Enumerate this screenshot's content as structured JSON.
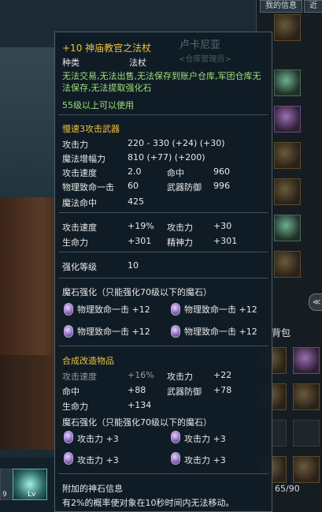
{
  "tooltip": {
    "enhance_level": "+10",
    "item_name": "神庙教官之法杖",
    "type_label": "种类",
    "type_value": "法杖",
    "restrictions": "无法交易,无法出售,无法保存到账户仓库,军团仓库无法保存,无法提取强化石",
    "level_req": "55级以上可以使用",
    "weapon_class": "慢速3攻击武器",
    "stats": [
      {
        "label": "攻击力",
        "value": "220 - 330 (+24) (+30)"
      },
      {
        "label": "魔法增幅力",
        "value": "810 (+77) (+200)"
      }
    ],
    "stats_pairs": [
      {
        "l1": "攻击速度",
        "v1": "2.0",
        "l2": "命中",
        "v2": "960"
      },
      {
        "l1": "物理致命一击",
        "v1": "60",
        "l2": "武器防御",
        "v2": "996"
      }
    ],
    "magic_hit": {
      "label": "魔法命中",
      "value": "425"
    },
    "bonus": [
      {
        "l1": "攻击速度",
        "v1": "+19%",
        "l2": "攻击力",
        "v2": "+30"
      },
      {
        "l1": "生命力",
        "v1": "+301",
        "l2": "精神力",
        "v2": "+301"
      }
    ],
    "enhance": {
      "label": "强化等级",
      "value": "10"
    },
    "manastone_header": "魔石强化（只能强化70级以下的魔石）",
    "manastones": [
      "物理致命一击 +12",
      "物理致命一击 +12",
      "物理致命一击 +12",
      "物理致命一击 +12"
    ],
    "fusion_header": "合成改造物品",
    "fusion_stats": [
      {
        "l1": "攻击速度",
        "v1": "+16%",
        "l2": "攻击力",
        "v2": "+22"
      },
      {
        "l1": "命中",
        "v1": "+88",
        "l2": "武器防御",
        "v2": "+78"
      },
      {
        "l1": "生命力",
        "v1": "+134",
        "l2": "",
        "v2": ""
      }
    ],
    "fusion_manastone_header": "魔石强化（只能强化70级以下的魔石）",
    "fusion_manastones": [
      "攻击力 +3",
      "攻击力 +3",
      "攻击力 +3",
      "攻击力 +3"
    ],
    "godstone_header": "附加的神石信息",
    "godstone_desc": "有2%的概率使对象在10秒时间内无法移动。"
  },
  "watermark": {
    "name": "卢卡尼亚",
    "sub": "<仓库管理员>"
  },
  "inventory": {
    "tab1": "我的信息",
    "tab2": "近",
    "bag_label": "背包",
    "count": "65/90",
    "side_button": "≪"
  },
  "hotbar": {
    "level_badge": "Lv",
    "slot_number": "9"
  }
}
